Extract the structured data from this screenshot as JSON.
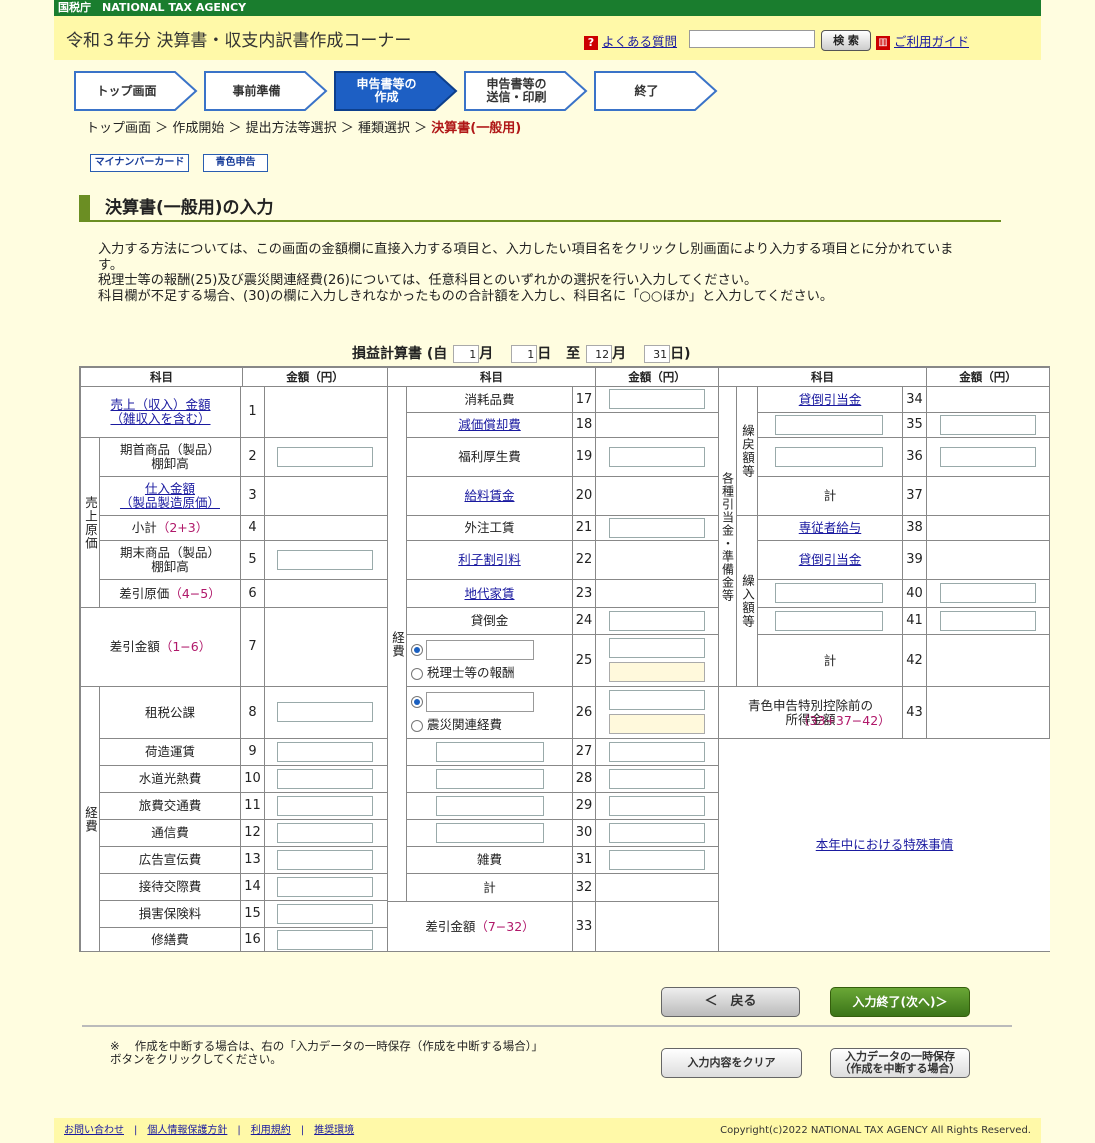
{
  "topbar": {
    "agency": "国税庁　NATIONAL TAX AGENCY"
  },
  "header": {
    "title": "令和３年分 決算書・収支内訳書作成コーナー",
    "faq_label": "よくある質問",
    "search_value": "",
    "search_button": "検 索",
    "guide_label": "ご利用ガイド"
  },
  "steps": [
    {
      "label": "トップ画面",
      "active": false
    },
    {
      "label": "事前準備",
      "active": false
    },
    {
      "label": "申告書等の\n作成",
      "active": true
    },
    {
      "label": "申告書等の\n送信・印刷",
      "active": false
    },
    {
      "label": "終了",
      "active": false
    }
  ],
  "breadcrumb": {
    "items": [
      "トップ画面",
      "作成開始",
      "提出方法等選択",
      "種類選択"
    ],
    "sep": "＞",
    "current": "決算書(一般用)"
  },
  "tags": {
    "mynumber": "マイナンバーカード",
    "blue": "青色申告"
  },
  "section_title": "決算書(一般用)の入力",
  "intro": {
    "line1": "入力する方法については、この画面の金額欄に直接入力する項目と、入力したい項目名をクリックし別画面により入力する項目とに分かれています。",
    "line2": "税理士等の報酬(25)及び震災関連経費(26)については、任意科目とのいずれかの選択を行い入力してください。",
    "line3": "科目欄が不足する場合、(30)の欄に入力しきれなかったものの合計額を入力し、科目名に「○○ほか」と入力してください。"
  },
  "pl": {
    "title": "損益計算書",
    "from_label": "(自",
    "to_label": "至",
    "close_paren": ")",
    "month_unit": "月",
    "day_unit": "日",
    "from_month": "1",
    "from_day": "1",
    "to_month": "12",
    "to_day": "31"
  },
  "table": {
    "head_item": "科目",
    "head_amount": "金額（円）",
    "g1": "売上原価",
    "g2": "経費",
    "g3": "経費",
    "g4": "各種引当金・準備金等",
    "g5": "繰戻額等",
    "g6": "繰入額等",
    "r1": "売上（収入）金額\n（雑収入を含む）",
    "r2": "期首商品（製品）\n棚卸高",
    "r3": "仕入金額\n（製品製造原価）",
    "r4a": "小計",
    "r4b": "（2+3）",
    "r5": "期末商品（製品）\n棚卸高",
    "r6a": "差引原価",
    "r6b": "（4−5）",
    "r7a": "差引金額",
    "r7b": "（1−6）",
    "r8": "租税公課",
    "r9": "荷造運賃",
    "r10": "水道光熱費",
    "r11": "旅費交通費",
    "r12": "通信費",
    "r13": "広告宣伝費",
    "r14": "接待交際費",
    "r15": "損害保険料",
    "r16": "修繕費",
    "r17": "消耗品費",
    "r18": "減価償却費",
    "r19": "福利厚生費",
    "r20": "給料賃金",
    "r21": "外注工賃",
    "r22": "利子割引料",
    "r23": "地代家賃",
    "r24": "貸倒金",
    "r25": "税理士等の報酬",
    "r26": "震災関連経費",
    "r31": "雑費",
    "r32": "計",
    "r33a": "差引金額",
    "r33b": "（7−32）",
    "r34": "貸倒引当金",
    "r37": "計",
    "r38": "専従者給与",
    "r39": "貸倒引当金",
    "r42": "計",
    "r43a": "青色申告特別控除前の\n所得金額",
    "r43b": "（33+37−42）",
    "special": "本年中における特殊事情"
  },
  "buttons": {
    "back": "＜　戻る",
    "next": "入力終了(次へ)＞",
    "clear": "入力内容をクリア",
    "save": "入力データの一時保存\n（作成を中断する場合）"
  },
  "note": "※　 作成を中断する場合は、右の「入力データの一時保存（作成を中断する場合）」ボタンをクリックしてください。",
  "footer": {
    "links": [
      "お問い合わせ",
      "個人情報保護方針",
      "利用規約",
      "推奨環境"
    ],
    "copyright": "Copyright(c)2022 NATIONAL TAX AGENCY All Rights Reserved."
  }
}
